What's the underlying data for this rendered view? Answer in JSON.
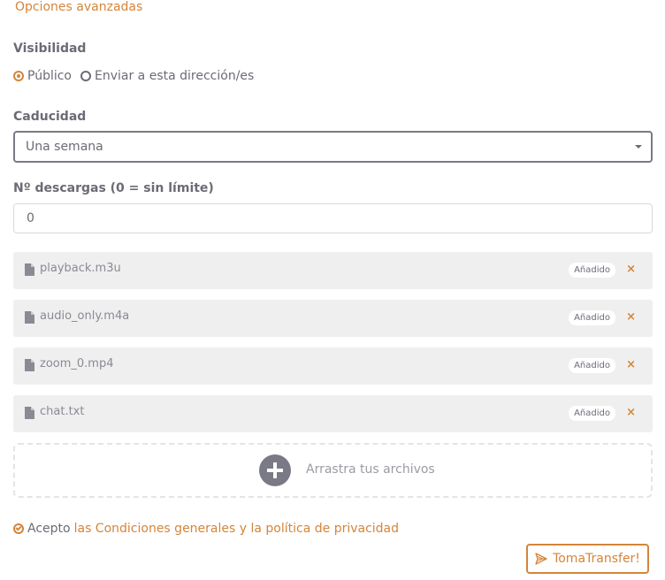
{
  "advanced_options_link": "Opciones avanzadas",
  "visibility": {
    "label": "Visibilidad",
    "options": [
      {
        "label": "Público",
        "checked": true
      },
      {
        "label": "Enviar a esta dirección/es",
        "checked": false
      }
    ]
  },
  "expiry": {
    "label": "Caducidad",
    "selected": "Una semana"
  },
  "downloads": {
    "label": "Nº descargas (0 = sin límite)",
    "value": "0"
  },
  "files": [
    {
      "name": "playback.m3u",
      "status": "Añadido"
    },
    {
      "name": "audio_only.m4a",
      "status": "Añadido"
    },
    {
      "name": "zoom_0.mp4",
      "status": "Añadido"
    },
    {
      "name": "chat.txt",
      "status": "Añadido"
    }
  ],
  "remove_symbol": "×",
  "dropzone_text": "Arrastra tus archivos",
  "terms": {
    "prefix": "Acepto",
    "link": "las Condiciones generales y la política de privacidad"
  },
  "submit_label": "TomaTransfer!",
  "icons": {
    "file": "file-icon",
    "add": "plus-circle-icon",
    "check": "check-circle-icon",
    "send": "paper-plane-icon"
  },
  "colors": {
    "accent": "#d4853a",
    "text": "#6b6b76",
    "file_row_bg": "#efefef"
  }
}
